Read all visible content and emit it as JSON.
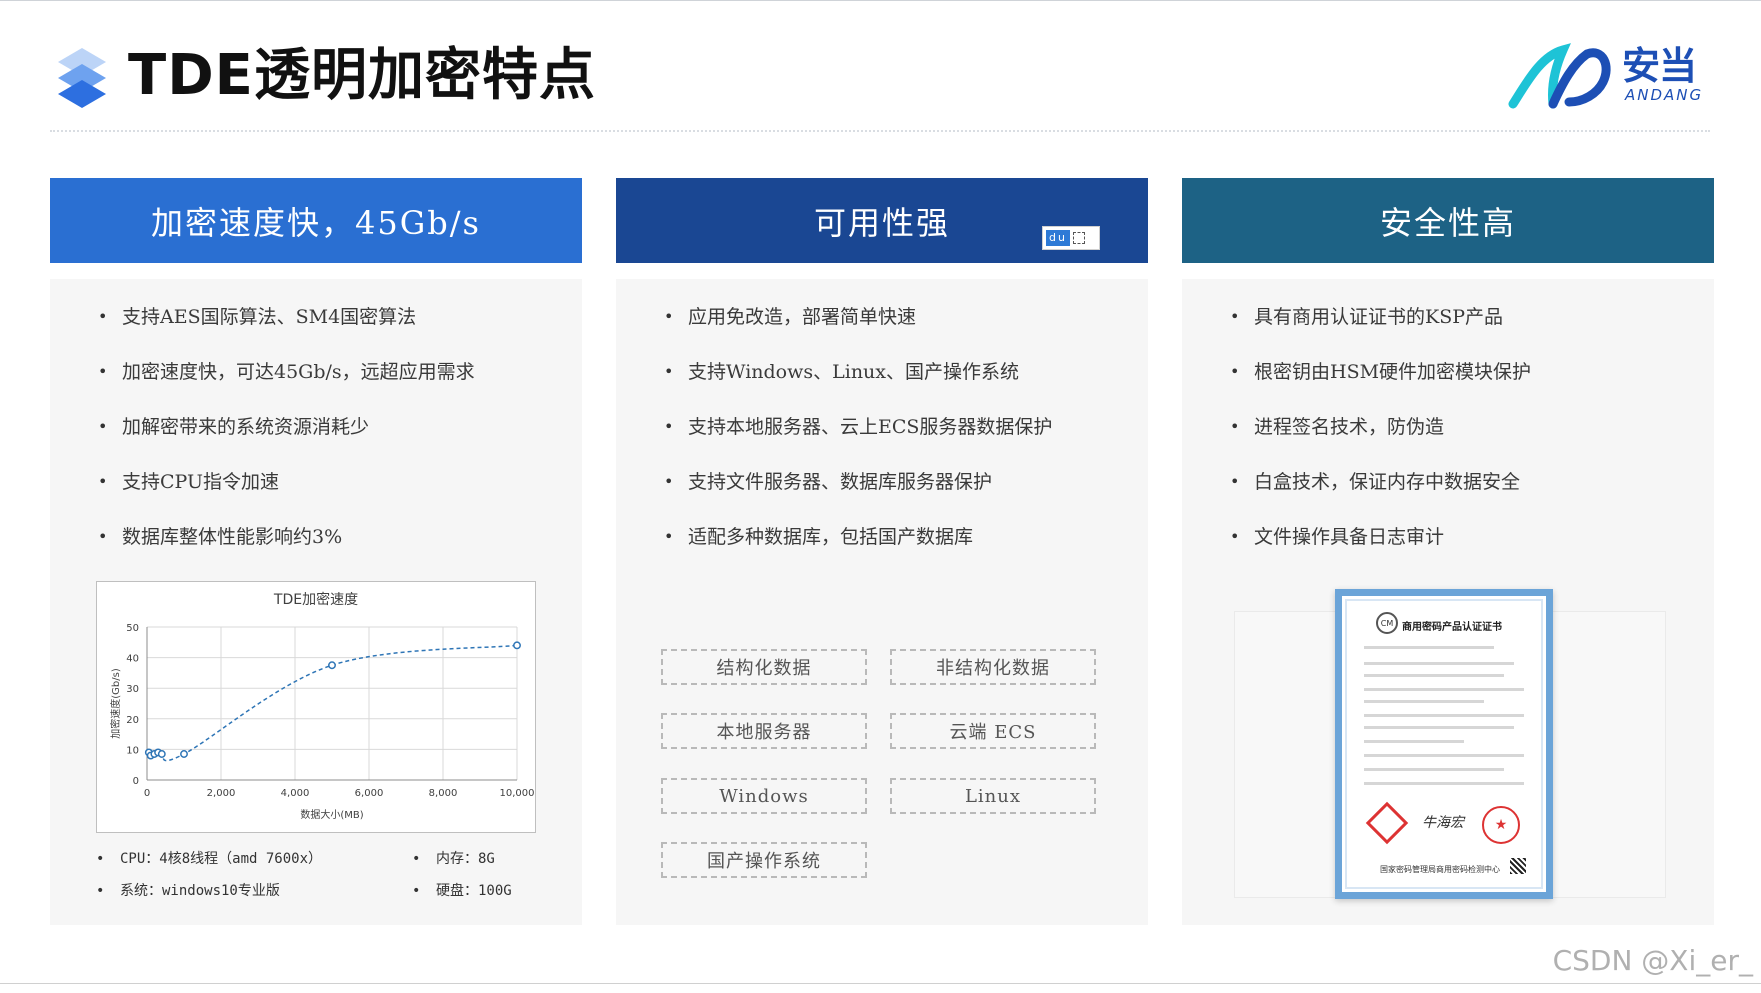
{
  "header": {
    "title": "TDE透明加密特点",
    "brand_cn": "安当",
    "brand_en": "ANDANG"
  },
  "columns": [
    {
      "heading": "加密速度快，45Gb/s",
      "bullets": [
        "支持AES国际算法、SM4国密算法",
        "加密速度快，可达45Gb/s，远超应用需求",
        "加解密带来的系统资源消耗少",
        "支持CPU指令加速",
        "数据库整体性能影响约3%"
      ],
      "specs": {
        "cpu": "CPU：4核8线程（amd 7600x）",
        "memory": "内存：8G",
        "os": "系统：windows10专业版",
        "disk": "硬盘：100G"
      }
    },
    {
      "heading": "可用性强",
      "badge": "du",
      "bullets": [
        "应用免改造，部署简单快速",
        "支持Windows、Linux、国产操作系统",
        "支持本地服务器、云上ECS服务器数据保护",
        "支持文件服务器、数据库服务器保护",
        "适配多种数据库，包括国产数据库"
      ],
      "tags": [
        "结构化数据",
        "非结构化数据",
        "本地服务器",
        "云端 ECS",
        "Windows",
        "Linux",
        "国产操作系统"
      ]
    },
    {
      "heading": "安全性高",
      "bullets": [
        "具有商用认证证书的KSP产品",
        "根密钥由HSM硬件加密模块保护",
        "进程签名技术，防伪造",
        "白盒技术，保证内存中数据安全",
        "文件操作具备日志审计"
      ],
      "certificate": {
        "logo": "CM",
        "title": "商用密码产品认证证书",
        "signature": "牛海宏",
        "footer": "国家密码管理局商用密码检测中心"
      }
    }
  ],
  "chart_data": {
    "type": "line",
    "title": "TDE加密速度",
    "xlabel": "数据大小(MB)",
    "ylabel": "加密速度(Gb/s)",
    "xlim": [
      0,
      10000
    ],
    "ylim": [
      0,
      50
    ],
    "xticks": [
      "0",
      "2,000",
      "4,000",
      "6,000",
      "8,000",
      "10,000"
    ],
    "yticks": [
      "0",
      "10",
      "20",
      "30",
      "40",
      "50"
    ],
    "grid": true,
    "line_color": "#2e75b6",
    "series": [
      {
        "x": [
          50,
          100,
          200,
          300,
          400,
          1000,
          5000,
          10000
        ],
        "y": [
          9,
          8,
          8.5,
          9,
          8.5,
          8.5,
          37.5,
          44
        ]
      }
    ]
  },
  "watermark": "CSDN @Xi_er_"
}
